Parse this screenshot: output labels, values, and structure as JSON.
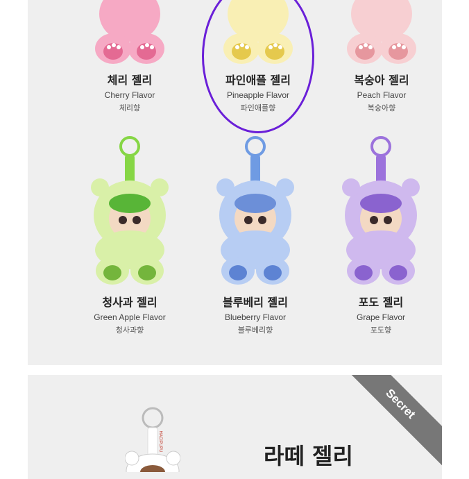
{
  "products_top": [
    {
      "name_ko": "체리 젤리",
      "name_en": "Cherry Flavor",
      "scent": "체리향",
      "color": "#f6a9c4",
      "paw": "#e46a93"
    },
    {
      "name_ko": "파인애플 젤리",
      "name_en": "Pineapple Flavor",
      "scent": "파인애플향",
      "color": "#f9efb4",
      "paw": "#e5c94d"
    },
    {
      "name_ko": "복숭아 젤리",
      "name_en": "Peach Flavor",
      "scent": "복숭아향",
      "color": "#f7cfd2",
      "paw": "#e6979e"
    }
  ],
  "products_bottom": [
    {
      "name_ko": "청사과 젤리",
      "name_en": "Green Apple Flavor",
      "scent": "청사과향",
      "color": "#d9f0a8",
      "paw": "#74b53c",
      "ring": "#86d645"
    },
    {
      "name_ko": "블루베리 젤리",
      "name_en": "Blueberry Flavor",
      "scent": "블루베리향",
      "color": "#b7cdf3",
      "paw": "#5d83d3",
      "ring": "#6f9be3"
    },
    {
      "name_ko": "포도 젤리",
      "name_en": "Grape Flavor",
      "scent": "포도향",
      "color": "#cfb9ee",
      "paw": "#8a63cf",
      "ring": "#9c72dc"
    }
  ],
  "secret": {
    "ribbon": "Secret",
    "title": "라떼 젤리",
    "color": "#ffffff",
    "paw": "#8a5a3b"
  },
  "brand_strap": "HACIPUPU"
}
